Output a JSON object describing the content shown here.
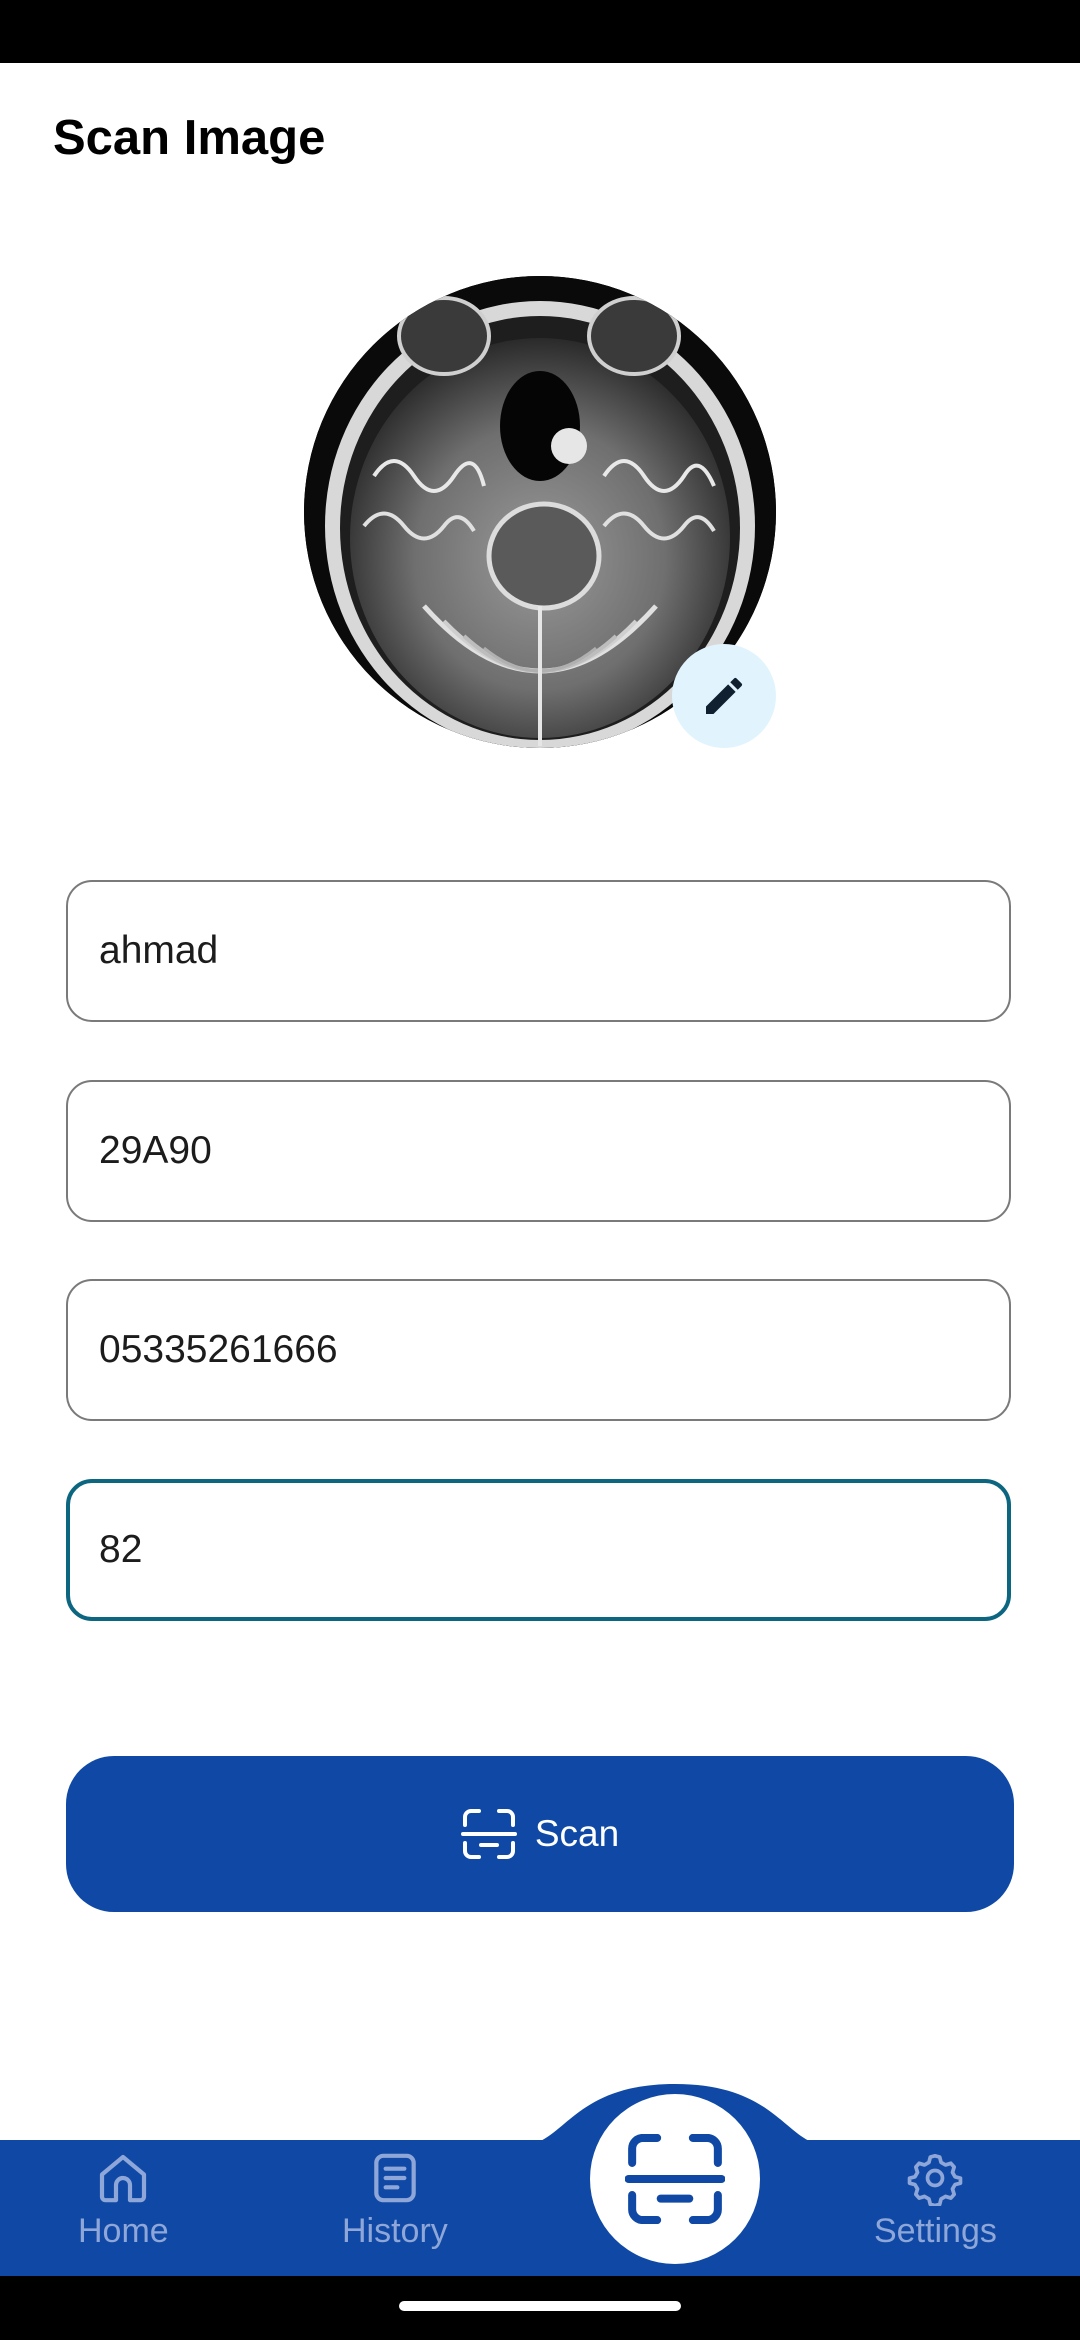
{
  "header": {
    "title": "Scan Image"
  },
  "form": {
    "name_value": "ahmad",
    "id_value": "29A90",
    "phone_value": "05335261666",
    "age_value": "82"
  },
  "actions": {
    "scan_label": "Scan"
  },
  "bottom_nav": {
    "items": [
      {
        "label": "Home",
        "icon": "home-icon"
      },
      {
        "label": "History",
        "icon": "history-icon"
      },
      {
        "label": "",
        "icon": "scan-icon"
      },
      {
        "label": "Settings",
        "icon": "gear-icon"
      }
    ]
  },
  "colors": {
    "primary": "#1049a5",
    "focus_border": "#0d6680",
    "edit_button_bg": "#e1f4fd",
    "nav_inactive": "#8ea7d8"
  }
}
